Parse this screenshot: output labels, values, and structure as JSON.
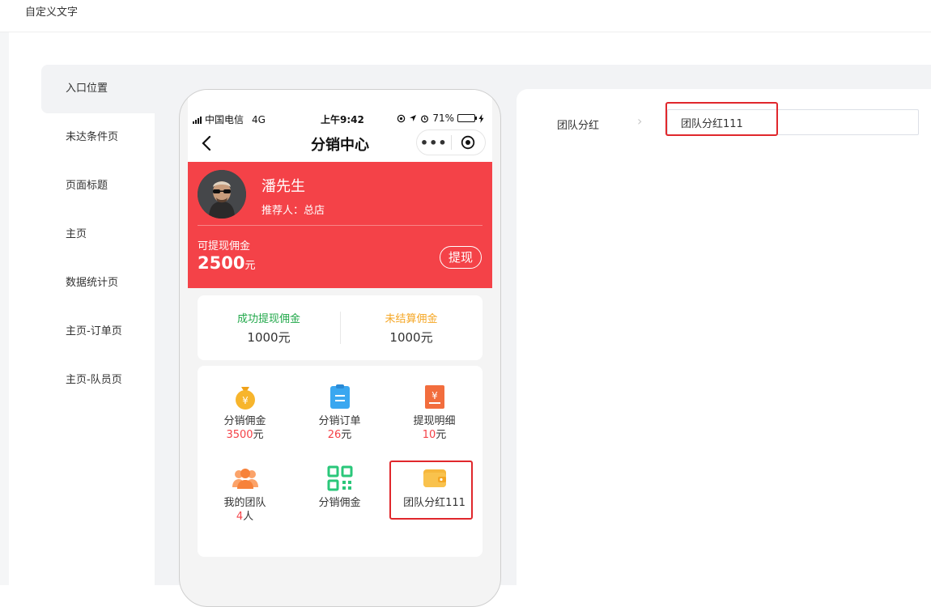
{
  "page": {
    "title": "自定义文字"
  },
  "sidebar": {
    "active_index": 0,
    "items": [
      {
        "label": "入口位置"
      },
      {
        "label": "未达条件页"
      },
      {
        "label": "页面标题"
      },
      {
        "label": "主页"
      },
      {
        "label": "数据统计页"
      },
      {
        "label": "主页-订单页"
      },
      {
        "label": "主页-队员页"
      }
    ]
  },
  "phone": {
    "status_bar": {
      "carrier": "中国电信",
      "network": "4G",
      "time": "上午9:42",
      "battery": "71%",
      "battery_level": 0.71
    },
    "nav": {
      "title": "分销中心",
      "more_glyph": "•••"
    },
    "hero": {
      "name": "潘先生",
      "referrer": "推荐人：总店",
      "withdrawable_label": "可提现佣金",
      "withdrawable_amount": "2500",
      "withdrawable_unit": "元",
      "withdraw_button": "提现"
    },
    "stats": [
      {
        "label": "成功提现佣金",
        "value": "1000元",
        "color": "#21a84a"
      },
      {
        "label": "未结算佣金",
        "value": "1000元",
        "color": "#f5a623"
      }
    ],
    "grid": [
      {
        "icon": "money-bag-icon",
        "label": "分销佣金",
        "value": "3500",
        "unit": "元"
      },
      {
        "icon": "clipboard-icon",
        "label": "分销订单",
        "value": "26",
        "unit": "元"
      },
      {
        "icon": "withdraw-detail-icon",
        "label": "提现明细",
        "value": "10",
        "unit": "元"
      },
      {
        "icon": "team-icon",
        "label": "我的团队",
        "value": "4",
        "unit": "人"
      },
      {
        "icon": "qr-code-icon",
        "label": "分销佣金",
        "value": "",
        "unit": ""
      },
      {
        "icon": "wallet-icon",
        "label": "团队分红111",
        "value": "",
        "unit": ""
      }
    ]
  },
  "settings": {
    "field_label": "团队分红",
    "input_value": "团队分红111"
  },
  "colors": {
    "brand_red": "#f44248",
    "highlight_red": "#e0272c",
    "success_green": "#21a84a",
    "pending_orange": "#f5a623"
  }
}
